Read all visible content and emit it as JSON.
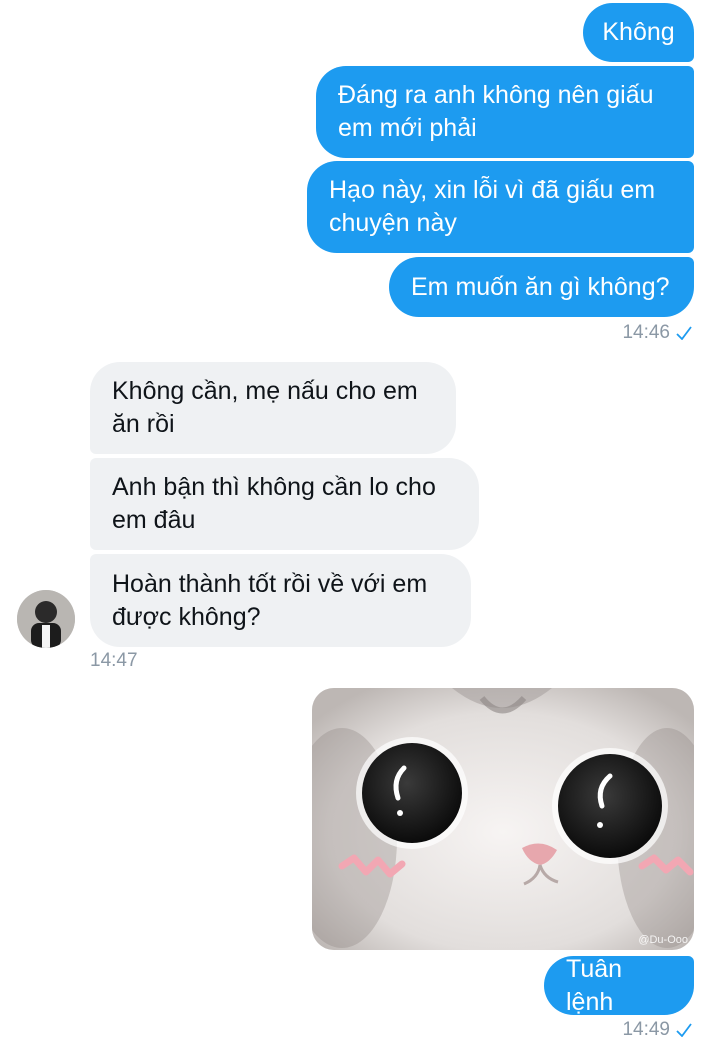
{
  "colors": {
    "outgoing_bubble": "#1d9bf0",
    "incoming_bubble": "#eff1f3",
    "timestamp": "#8b98a5",
    "read_check": "#1d9bf0"
  },
  "messages": {
    "out_1": "Không",
    "out_2": "Đáng ra anh không nên giấu\nem mới phải",
    "out_3": "Hạo này, xin lỗi vì đã giấu em\nchuyện này",
    "out_4": "Em muốn ăn gì không?",
    "time_1": "14:46",
    "in_1": "Không cần, mẹ nấu cho em\năn rồi",
    "in_2": "Anh bận thì không cần lo cho\nem đâu",
    "in_3": "Hoàn thành tốt rồi về với em\nđược không?",
    "time_2": "14:47",
    "photo_watermark": "@Du-Ooo",
    "out_5": "Tuân lệnh",
    "time_3": "14:49"
  },
  "icons": {
    "read_receipt": "checkmark-icon",
    "avatar": "avatar-icon",
    "photo": "cat-sticker-image"
  }
}
